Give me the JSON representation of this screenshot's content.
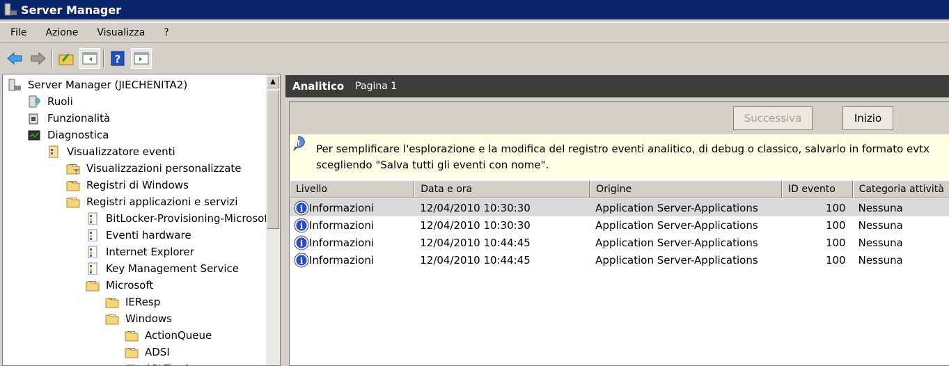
{
  "window": {
    "title": "Server Manager"
  },
  "menu": [
    "File",
    "Azione",
    "Visualizza",
    "?"
  ],
  "toolbar": [
    "back-icon",
    "forward-icon",
    "up-folder-icon",
    "show-hide-console-tree-icon",
    "help-icon",
    "show-hide-action-pane-icon"
  ],
  "tree": [
    {
      "label": "Server Manager (JIECHENITA2)",
      "level": 0,
      "expander": "",
      "icon": "server-icon"
    },
    {
      "label": "Ruoli",
      "level": 1,
      "expander": "+",
      "icon": "roles-icon"
    },
    {
      "label": "Funzionalità",
      "level": 1,
      "expander": "",
      "icon": "features-icon"
    },
    {
      "label": "Diagnostica",
      "level": 1,
      "expander": "-",
      "icon": "diagnostics-icon"
    },
    {
      "label": "Visualizzatore eventi",
      "level": 2,
      "expander": "-",
      "icon": "event-viewer-icon"
    },
    {
      "label": "Visualizzazioni personalizzate",
      "level": 3,
      "expander": "+",
      "icon": "folder-filter-icon"
    },
    {
      "label": "Registri di Windows",
      "level": 3,
      "expander": "+",
      "icon": "folder-icon"
    },
    {
      "label": "Registri applicazioni e servizi",
      "level": 3,
      "expander": "-",
      "icon": "folder-icon"
    },
    {
      "label": "BitLocker-Provisioning-Microsoft",
      "level": 4,
      "expander": "",
      "icon": "log-icon"
    },
    {
      "label": "Eventi hardware",
      "level": 4,
      "expander": "",
      "icon": "log-icon"
    },
    {
      "label": "Internet Explorer",
      "level": 4,
      "expander": "",
      "icon": "log-icon"
    },
    {
      "label": "Key Management Service",
      "level": 4,
      "expander": "",
      "icon": "log-icon"
    },
    {
      "label": "Microsoft",
      "level": 4,
      "expander": "-",
      "icon": "folder-icon"
    },
    {
      "label": "IEResp",
      "level": 5,
      "expander": "+",
      "icon": "folder-icon"
    },
    {
      "label": "Windows",
      "level": 5,
      "expander": "-",
      "icon": "folder-icon"
    },
    {
      "label": "ActionQueue",
      "level": 6,
      "expander": "+",
      "icon": "folder-icon"
    },
    {
      "label": "ADSI",
      "level": 6,
      "expander": "+",
      "icon": "folder-icon"
    },
    {
      "label": "API-Tracing",
      "level": 6,
      "expander": "+",
      "icon": "folder-icon"
    }
  ],
  "header": {
    "title": "Analitico",
    "page": "Pagina 1"
  },
  "buttons": {
    "next": "Successiva",
    "start": "Inizio"
  },
  "info": "Per semplificare l'esplorazione e la modifica del registro eventi analitico, di debug o classico, salvarlo in formato evtx scegliendo \"Salva tutti gli eventi con nome\".",
  "table": {
    "columns": [
      "Livello",
      "Data e ora",
      "Origine",
      "ID evento",
      "Categoria attività"
    ],
    "rows": [
      [
        "Informazioni",
        "12/04/2010 10:30:30",
        "Application Server-Applications",
        "100",
        "Nessuna"
      ],
      [
        "Informazioni",
        "12/04/2010 10:30:30",
        "Application Server-Applications",
        "100",
        "Nessuna"
      ],
      [
        "Informazioni",
        "12/04/2010 10:44:45",
        "Application Server-Applications",
        "100",
        "Nessuna"
      ],
      [
        "Informazioni",
        "12/04/2010 10:44:45",
        "Application Server-Applications",
        "100",
        "Nessuna"
      ]
    ]
  },
  "colors": {
    "titlebar": "#0a246a",
    "header": "#3c3c3c",
    "info_bg": "#ffffe6",
    "selected_row": "#d9d9d9"
  }
}
